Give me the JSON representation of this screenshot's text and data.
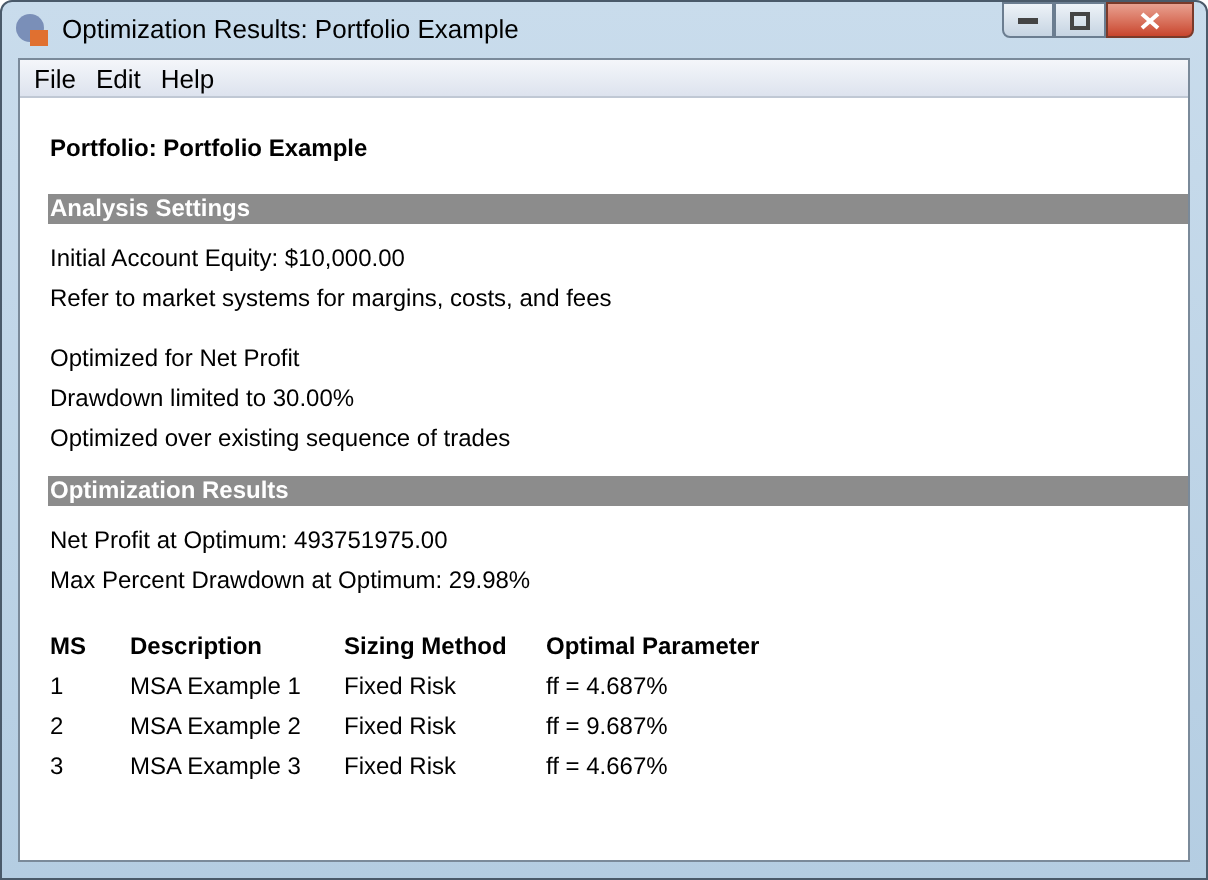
{
  "window": {
    "title": "Optimization Results: Portfolio Example"
  },
  "menu": [
    "File",
    "Edit",
    "Help"
  ],
  "portfolio": "Portfolio: Portfolio Example",
  "sections": [
    {
      "heading": "Analysis Settings",
      "groups": [
        [
          "Initial Account Equity: $10,000.00",
          "Refer to market systems for margins, costs, and fees"
        ],
        [
          "Optimized for Net Profit",
          "Drawdown limited to 30.00%",
          "Optimized over existing sequence of trades"
        ]
      ]
    },
    {
      "heading": "Optimization Results",
      "groups": [
        [
          "Net Profit at Optimum: 493751975.00",
          "Max Percent Drawdown at Optimum: 29.98%"
        ]
      ]
    }
  ],
  "table": {
    "columns": [
      "MS",
      "Description",
      "Sizing Method",
      "Optimal Parameter"
    ],
    "rows": [
      [
        "1",
        "MSA Example 1",
        "Fixed Risk",
        "ff = 4.687%"
      ],
      [
        "2",
        "MSA Example 2",
        "Fixed Risk",
        "ff = 9.687%"
      ],
      [
        "3",
        "MSA Example 3",
        "Fixed Risk",
        "ff = 4.667%"
      ]
    ]
  }
}
